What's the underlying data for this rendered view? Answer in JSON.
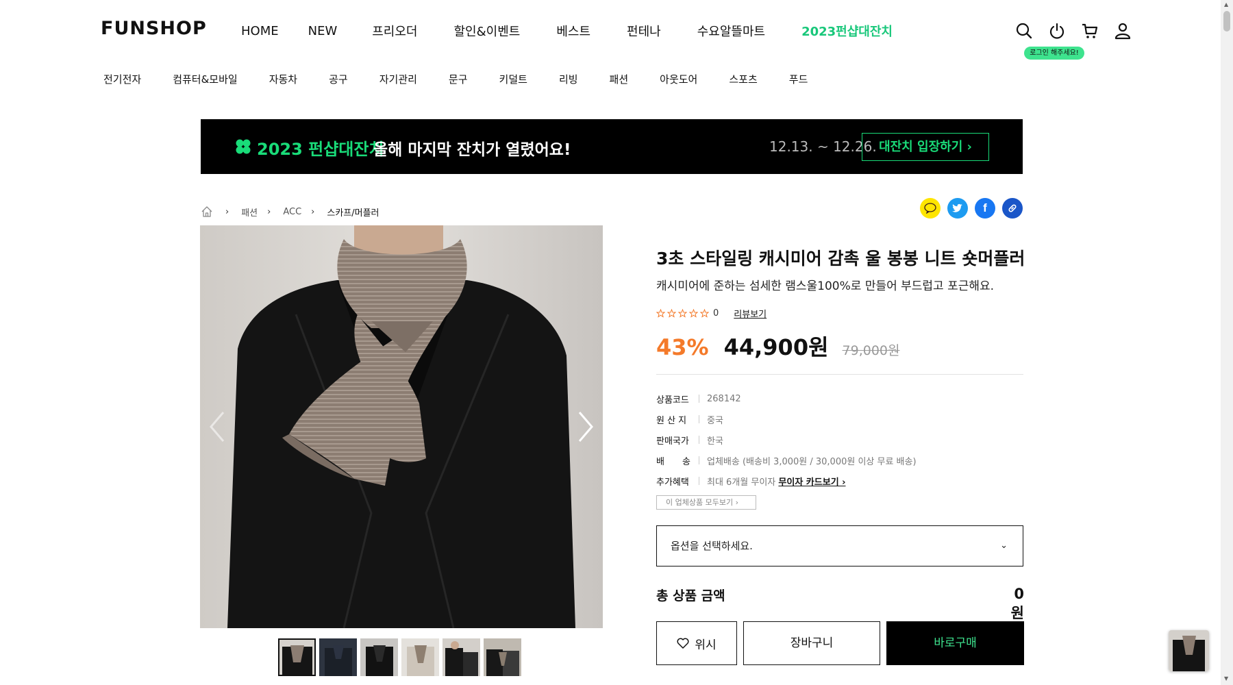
{
  "header": {
    "logo": "FUNSHOP",
    "nav": [
      "HOME",
      "NEW",
      "프리오더",
      "할인&이벤트",
      "베스트",
      "펀테나",
      "수요알뜰마트",
      "2023펀샵대잔치"
    ],
    "login_tip": "로그인 해주세요!"
  },
  "categories": [
    "전기전자",
    "컴퓨터&모바일",
    "자동차",
    "공구",
    "자기관리",
    "문구",
    "키덜트",
    "리빙",
    "패션",
    "아웃도어",
    "스포츠",
    "푸드"
  ],
  "banner": {
    "title": "2023 펀샵대잔치",
    "subtitle": "올해 마지막 잔치가 열렸어요!",
    "date": "12.13. ~ 12.26.",
    "button": "대잔치 입장하기 ›"
  },
  "breadcrumb": [
    "패션",
    "ACC",
    "스카프/머플러"
  ],
  "product": {
    "title": "3초 스타일링 캐시미어 감촉 울 봉봉 니트 숏머플러",
    "description": "캐시미어에 준하는 섬세한 램스울100%로 만들어 부드럽고 포근해요.",
    "rating_count": "0",
    "review_link": "리뷰보기",
    "discount": "43%",
    "price": "44,900원",
    "original_price": "79,000원",
    "specs": [
      {
        "label": "상품코드",
        "value": "268142"
      },
      {
        "label": "원 산 지",
        "value": "중국"
      },
      {
        "label": "판매국가",
        "value": "한국"
      },
      {
        "label": "배　　송",
        "value": "업체배송 (배송비 3,000원 / 30,000원 이상 무료 배송)"
      },
      {
        "label": "추가혜택",
        "value": "최대 6개월 무이자",
        "link": "무이자 카드보기 ›"
      }
    ],
    "seller_all": "이 업체상품 모두보기 ›",
    "option_placeholder": "옵션을 선택하세요.",
    "total_label": "총 상품 금액",
    "total_value": "0 원",
    "wish_label": "위시",
    "cart_label": "장바구니",
    "buy_label": "바로구매"
  },
  "colors": {
    "accent_green": "#19dc79",
    "discount_orange": "#f47a2a"
  },
  "icons": [
    "search-icon",
    "power-icon",
    "cart-icon",
    "user-icon",
    "home-icon",
    "kakao-icon",
    "twitter-icon",
    "facebook-icon",
    "link-icon",
    "heart-icon"
  ]
}
